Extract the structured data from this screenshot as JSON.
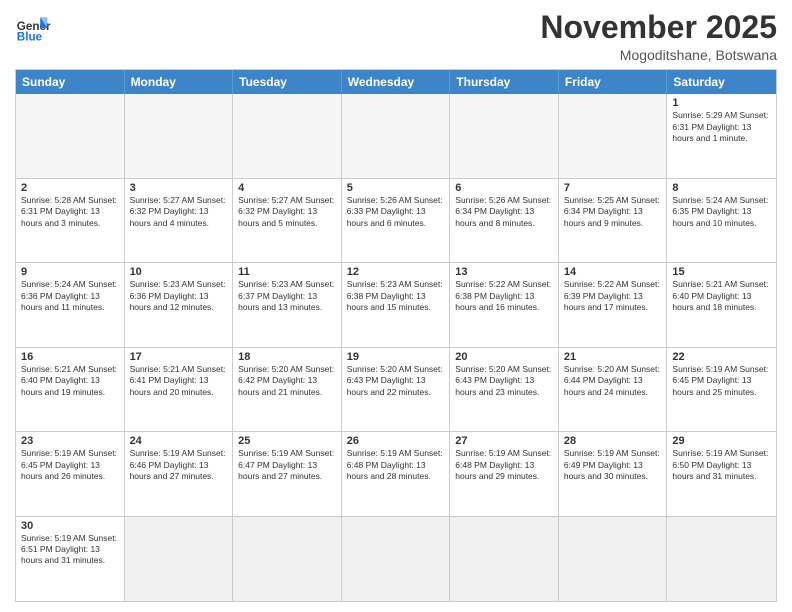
{
  "header": {
    "logo_general": "General",
    "logo_blue": "Blue",
    "month_title": "November 2025",
    "location": "Mogoditshane, Botswana"
  },
  "day_headers": [
    "Sunday",
    "Monday",
    "Tuesday",
    "Wednesday",
    "Thursday",
    "Friday",
    "Saturday"
  ],
  "weeks": [
    [
      {
        "day": "",
        "info": ""
      },
      {
        "day": "",
        "info": ""
      },
      {
        "day": "",
        "info": ""
      },
      {
        "day": "",
        "info": ""
      },
      {
        "day": "",
        "info": ""
      },
      {
        "day": "",
        "info": ""
      },
      {
        "day": "1",
        "info": "Sunrise: 5:29 AM\nSunset: 6:31 PM\nDaylight: 13 hours\nand 1 minute."
      }
    ],
    [
      {
        "day": "2",
        "info": "Sunrise: 5:28 AM\nSunset: 6:31 PM\nDaylight: 13 hours\nand 3 minutes."
      },
      {
        "day": "3",
        "info": "Sunrise: 5:27 AM\nSunset: 6:32 PM\nDaylight: 13 hours\nand 4 minutes."
      },
      {
        "day": "4",
        "info": "Sunrise: 5:27 AM\nSunset: 6:32 PM\nDaylight: 13 hours\nand 5 minutes."
      },
      {
        "day": "5",
        "info": "Sunrise: 5:26 AM\nSunset: 6:33 PM\nDaylight: 13 hours\nand 6 minutes."
      },
      {
        "day": "6",
        "info": "Sunrise: 5:26 AM\nSunset: 6:34 PM\nDaylight: 13 hours\nand 8 minutes."
      },
      {
        "day": "7",
        "info": "Sunrise: 5:25 AM\nSunset: 6:34 PM\nDaylight: 13 hours\nand 9 minutes."
      },
      {
        "day": "8",
        "info": "Sunrise: 5:24 AM\nSunset: 6:35 PM\nDaylight: 13 hours\nand 10 minutes."
      }
    ],
    [
      {
        "day": "9",
        "info": "Sunrise: 5:24 AM\nSunset: 6:36 PM\nDaylight: 13 hours\nand 11 minutes."
      },
      {
        "day": "10",
        "info": "Sunrise: 5:23 AM\nSunset: 6:36 PM\nDaylight: 13 hours\nand 12 minutes."
      },
      {
        "day": "11",
        "info": "Sunrise: 5:23 AM\nSunset: 6:37 PM\nDaylight: 13 hours\nand 13 minutes."
      },
      {
        "day": "12",
        "info": "Sunrise: 5:23 AM\nSunset: 6:38 PM\nDaylight: 13 hours\nand 15 minutes."
      },
      {
        "day": "13",
        "info": "Sunrise: 5:22 AM\nSunset: 6:38 PM\nDaylight: 13 hours\nand 16 minutes."
      },
      {
        "day": "14",
        "info": "Sunrise: 5:22 AM\nSunset: 6:39 PM\nDaylight: 13 hours\nand 17 minutes."
      },
      {
        "day": "15",
        "info": "Sunrise: 5:21 AM\nSunset: 6:40 PM\nDaylight: 13 hours\nand 18 minutes."
      }
    ],
    [
      {
        "day": "16",
        "info": "Sunrise: 5:21 AM\nSunset: 6:40 PM\nDaylight: 13 hours\nand 19 minutes."
      },
      {
        "day": "17",
        "info": "Sunrise: 5:21 AM\nSunset: 6:41 PM\nDaylight: 13 hours\nand 20 minutes."
      },
      {
        "day": "18",
        "info": "Sunrise: 5:20 AM\nSunset: 6:42 PM\nDaylight: 13 hours\nand 21 minutes."
      },
      {
        "day": "19",
        "info": "Sunrise: 5:20 AM\nSunset: 6:43 PM\nDaylight: 13 hours\nand 22 minutes."
      },
      {
        "day": "20",
        "info": "Sunrise: 5:20 AM\nSunset: 6:43 PM\nDaylight: 13 hours\nand 23 minutes."
      },
      {
        "day": "21",
        "info": "Sunrise: 5:20 AM\nSunset: 6:44 PM\nDaylight: 13 hours\nand 24 minutes."
      },
      {
        "day": "22",
        "info": "Sunrise: 5:19 AM\nSunset: 6:45 PM\nDaylight: 13 hours\nand 25 minutes."
      }
    ],
    [
      {
        "day": "23",
        "info": "Sunrise: 5:19 AM\nSunset: 6:45 PM\nDaylight: 13 hours\nand 26 minutes."
      },
      {
        "day": "24",
        "info": "Sunrise: 5:19 AM\nSunset: 6:46 PM\nDaylight: 13 hours\nand 27 minutes."
      },
      {
        "day": "25",
        "info": "Sunrise: 5:19 AM\nSunset: 6:47 PM\nDaylight: 13 hours\nand 27 minutes."
      },
      {
        "day": "26",
        "info": "Sunrise: 5:19 AM\nSunset: 6:48 PM\nDaylight: 13 hours\nand 28 minutes."
      },
      {
        "day": "27",
        "info": "Sunrise: 5:19 AM\nSunset: 6:48 PM\nDaylight: 13 hours\nand 29 minutes."
      },
      {
        "day": "28",
        "info": "Sunrise: 5:19 AM\nSunset: 6:49 PM\nDaylight: 13 hours\nand 30 minutes."
      },
      {
        "day": "29",
        "info": "Sunrise: 5:19 AM\nSunset: 6:50 PM\nDaylight: 13 hours\nand 31 minutes."
      }
    ],
    [
      {
        "day": "30",
        "info": "Sunrise: 5:19 AM\nSunset: 6:51 PM\nDaylight: 13 hours\nand 31 minutes."
      },
      {
        "day": "",
        "info": ""
      },
      {
        "day": "",
        "info": ""
      },
      {
        "day": "",
        "info": ""
      },
      {
        "day": "",
        "info": ""
      },
      {
        "day": "",
        "info": ""
      },
      {
        "day": "",
        "info": ""
      }
    ]
  ]
}
